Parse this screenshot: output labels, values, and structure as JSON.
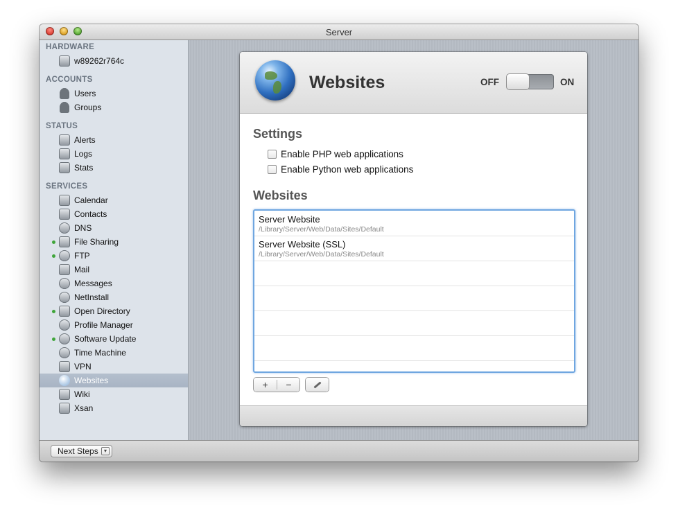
{
  "window": {
    "title": "Server"
  },
  "sidebar": {
    "sections": {
      "hardware": "HARDWARE",
      "accounts": "ACCOUNTS",
      "status": "STATUS",
      "services": "SERVICES"
    },
    "hardware_items": [
      {
        "label": "w89262r764c",
        "icon": "computer-icon"
      }
    ],
    "account_items": [
      {
        "label": "Users",
        "icon": "user-icon"
      },
      {
        "label": "Groups",
        "icon": "groups-icon"
      }
    ],
    "status_items": [
      {
        "label": "Alerts",
        "icon": "megaphone-icon"
      },
      {
        "label": "Logs",
        "icon": "document-icon"
      },
      {
        "label": "Stats",
        "icon": "bar-chart-icon"
      }
    ],
    "service_items": [
      {
        "label": "Calendar",
        "icon": "calendar-icon",
        "running": false
      },
      {
        "label": "Contacts",
        "icon": "contacts-icon",
        "running": false
      },
      {
        "label": "DNS",
        "icon": "dns-icon",
        "running": false
      },
      {
        "label": "File Sharing",
        "icon": "file-sharing-icon",
        "running": true
      },
      {
        "label": "FTP",
        "icon": "ftp-icon",
        "running": true
      },
      {
        "label": "Mail",
        "icon": "mail-icon",
        "running": false
      },
      {
        "label": "Messages",
        "icon": "messages-icon",
        "running": false
      },
      {
        "label": "NetInstall",
        "icon": "netinstall-icon",
        "running": false
      },
      {
        "label": "Open Directory",
        "icon": "open-directory-icon",
        "running": true
      },
      {
        "label": "Profile Manager",
        "icon": "profile-manager-icon",
        "running": false
      },
      {
        "label": "Software Update",
        "icon": "software-update-icon",
        "running": true
      },
      {
        "label": "Time Machine",
        "icon": "time-machine-icon",
        "running": false
      },
      {
        "label": "VPN",
        "icon": "vpn-icon",
        "running": false
      },
      {
        "label": "Websites",
        "icon": "globe-icon",
        "running": false,
        "selected": true
      },
      {
        "label": "Wiki",
        "icon": "wiki-icon",
        "running": false
      },
      {
        "label": "Xsan",
        "icon": "xsan-icon",
        "running": false
      }
    ]
  },
  "panel": {
    "title": "Websites",
    "switch": {
      "off_label": "OFF",
      "on_label": "ON",
      "state": "off"
    },
    "settings_title": "Settings",
    "settings": [
      {
        "label": "Enable PHP web applications",
        "checked": false
      },
      {
        "label": "Enable Python web applications",
        "checked": false
      }
    ],
    "websites_title": "Websites",
    "websites": [
      {
        "name": "Server Website",
        "path": "/Library/Server/Web/Data/Sites/Default"
      },
      {
        "name": "Server Website (SSL)",
        "path": "/Library/Server/Web/Data/Sites/Default"
      }
    ],
    "buttons": {
      "add": "+",
      "remove": "−"
    }
  },
  "bottom": {
    "next_steps": "Next Steps"
  },
  "colors": {
    "running_dot": "#3fa53a",
    "list_focus": "#6fa6e0",
    "selected_row": "#a8b4c4"
  }
}
